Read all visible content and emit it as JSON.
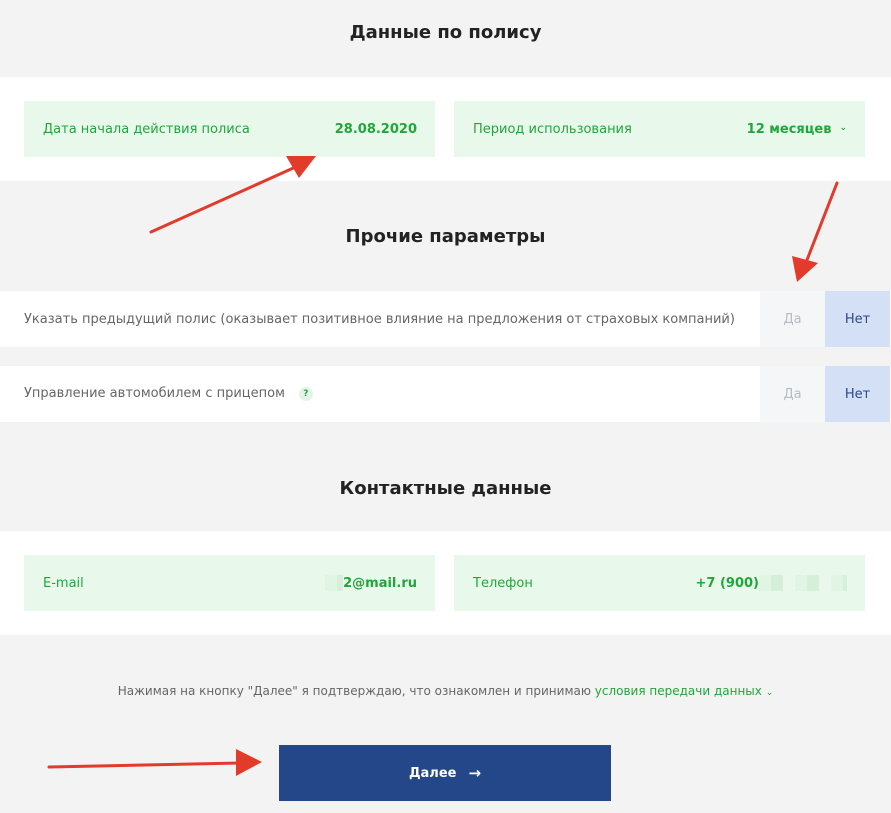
{
  "policy": {
    "title": "Данные по полису",
    "start_date_label": "Дата начала действия полиса",
    "start_date_value": "28.08.2020",
    "period_label": "Период использования",
    "period_value": "12 месяцев"
  },
  "other": {
    "title": "Прочие параметры",
    "prev_policy_label": "Указать предыдущий полис (оказывает позитивное влияние на предложения от страховых компаний)",
    "trailer_label": "Управление автомобилем с прицепом",
    "help_glyph": "?",
    "yes_label": "Да",
    "no_label": "Нет"
  },
  "contacts": {
    "title": "Контактные данные",
    "email_label": "E-mail",
    "email_value": "2@mail.ru",
    "phone_label": "Телефон",
    "phone_value": "+7 (900) "
  },
  "consent": {
    "text": "Нажимая на кнопку \"Далее\" я подтверждаю, что ознакомлен и принимаю ",
    "link": "условия передачи данных"
  },
  "next_button": {
    "label": "Далее",
    "arrow": "→"
  }
}
